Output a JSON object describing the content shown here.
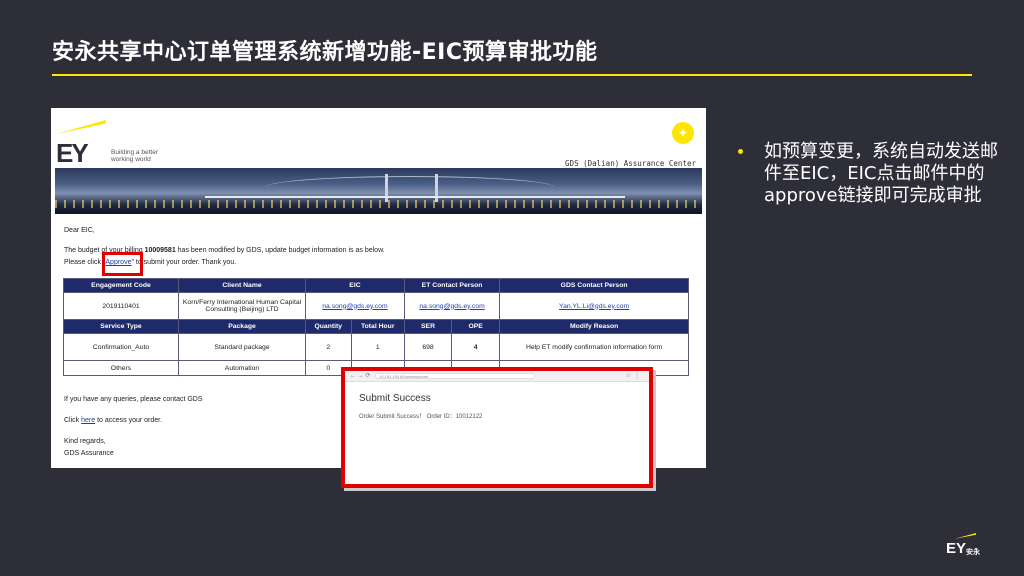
{
  "slide": {
    "title": "安永共享中心订单管理系统新增功能-EIC预算审批功能",
    "bullet": "如预算变更，系统自动发送邮件至EIC，EIC点击邮件中的approve链接即可完成审批"
  },
  "email": {
    "logo": "EY",
    "tagline_1": "Building a better",
    "tagline_2": "working world",
    "gds_center": "GDS (Dalian) Assurance Center",
    "greeting": "Dear EIC,",
    "body_pre": "The budget of your billing ",
    "billing_no": "10009581",
    "body_post": " has been modified by GDS, update budget information is as below.",
    "click_pre": "Please click \"",
    "approve_link": "Approve",
    "click_post": "\" to submit your order. Thank you.",
    "table1": {
      "headers": [
        "Engagement Code",
        "Client Name",
        "EIC",
        "ET Contact Person",
        "GDS Contact Person"
      ],
      "row": [
        "2019110401",
        "Korn/Ferry International Human Capital Consulting (Beijing) LTD",
        "na.song@gds.ey.com",
        "na.song@gds.ey.com",
        "Yan.YL.Li@gds.ey.com"
      ]
    },
    "table2": {
      "headers": [
        "Service Type",
        "Package",
        "Quantity",
        "Total Hour",
        "SER",
        "OPE",
        "Modify Reason"
      ],
      "rows": [
        [
          "Confirmation_Auto",
          "Standard package",
          "2",
          "1",
          "698",
          "4",
          "Help ET modify confirmation information form"
        ],
        [
          "Others",
          "Automation",
          "0",
          "",
          "",
          "",
          ""
        ]
      ]
    },
    "queries": "If you have any queries, please contact GDS",
    "access_pre": "Click ",
    "access_link": "here",
    "access_post": " to access your order.",
    "regards": "Kind regards,",
    "signature": "GDS Assurance"
  },
  "popup": {
    "url": "10.192.150.60/order/submit",
    "title": "Submit Success",
    "message": "Order Submit Success！ Order ID：10012122"
  },
  "footer": {
    "logo": "EY",
    "logo_cn": "安永"
  },
  "colors": {
    "background": "#2e2e38",
    "accent_yellow": "#ffe600",
    "table_header": "#1f2a6b",
    "highlight_red": "#e00000"
  }
}
